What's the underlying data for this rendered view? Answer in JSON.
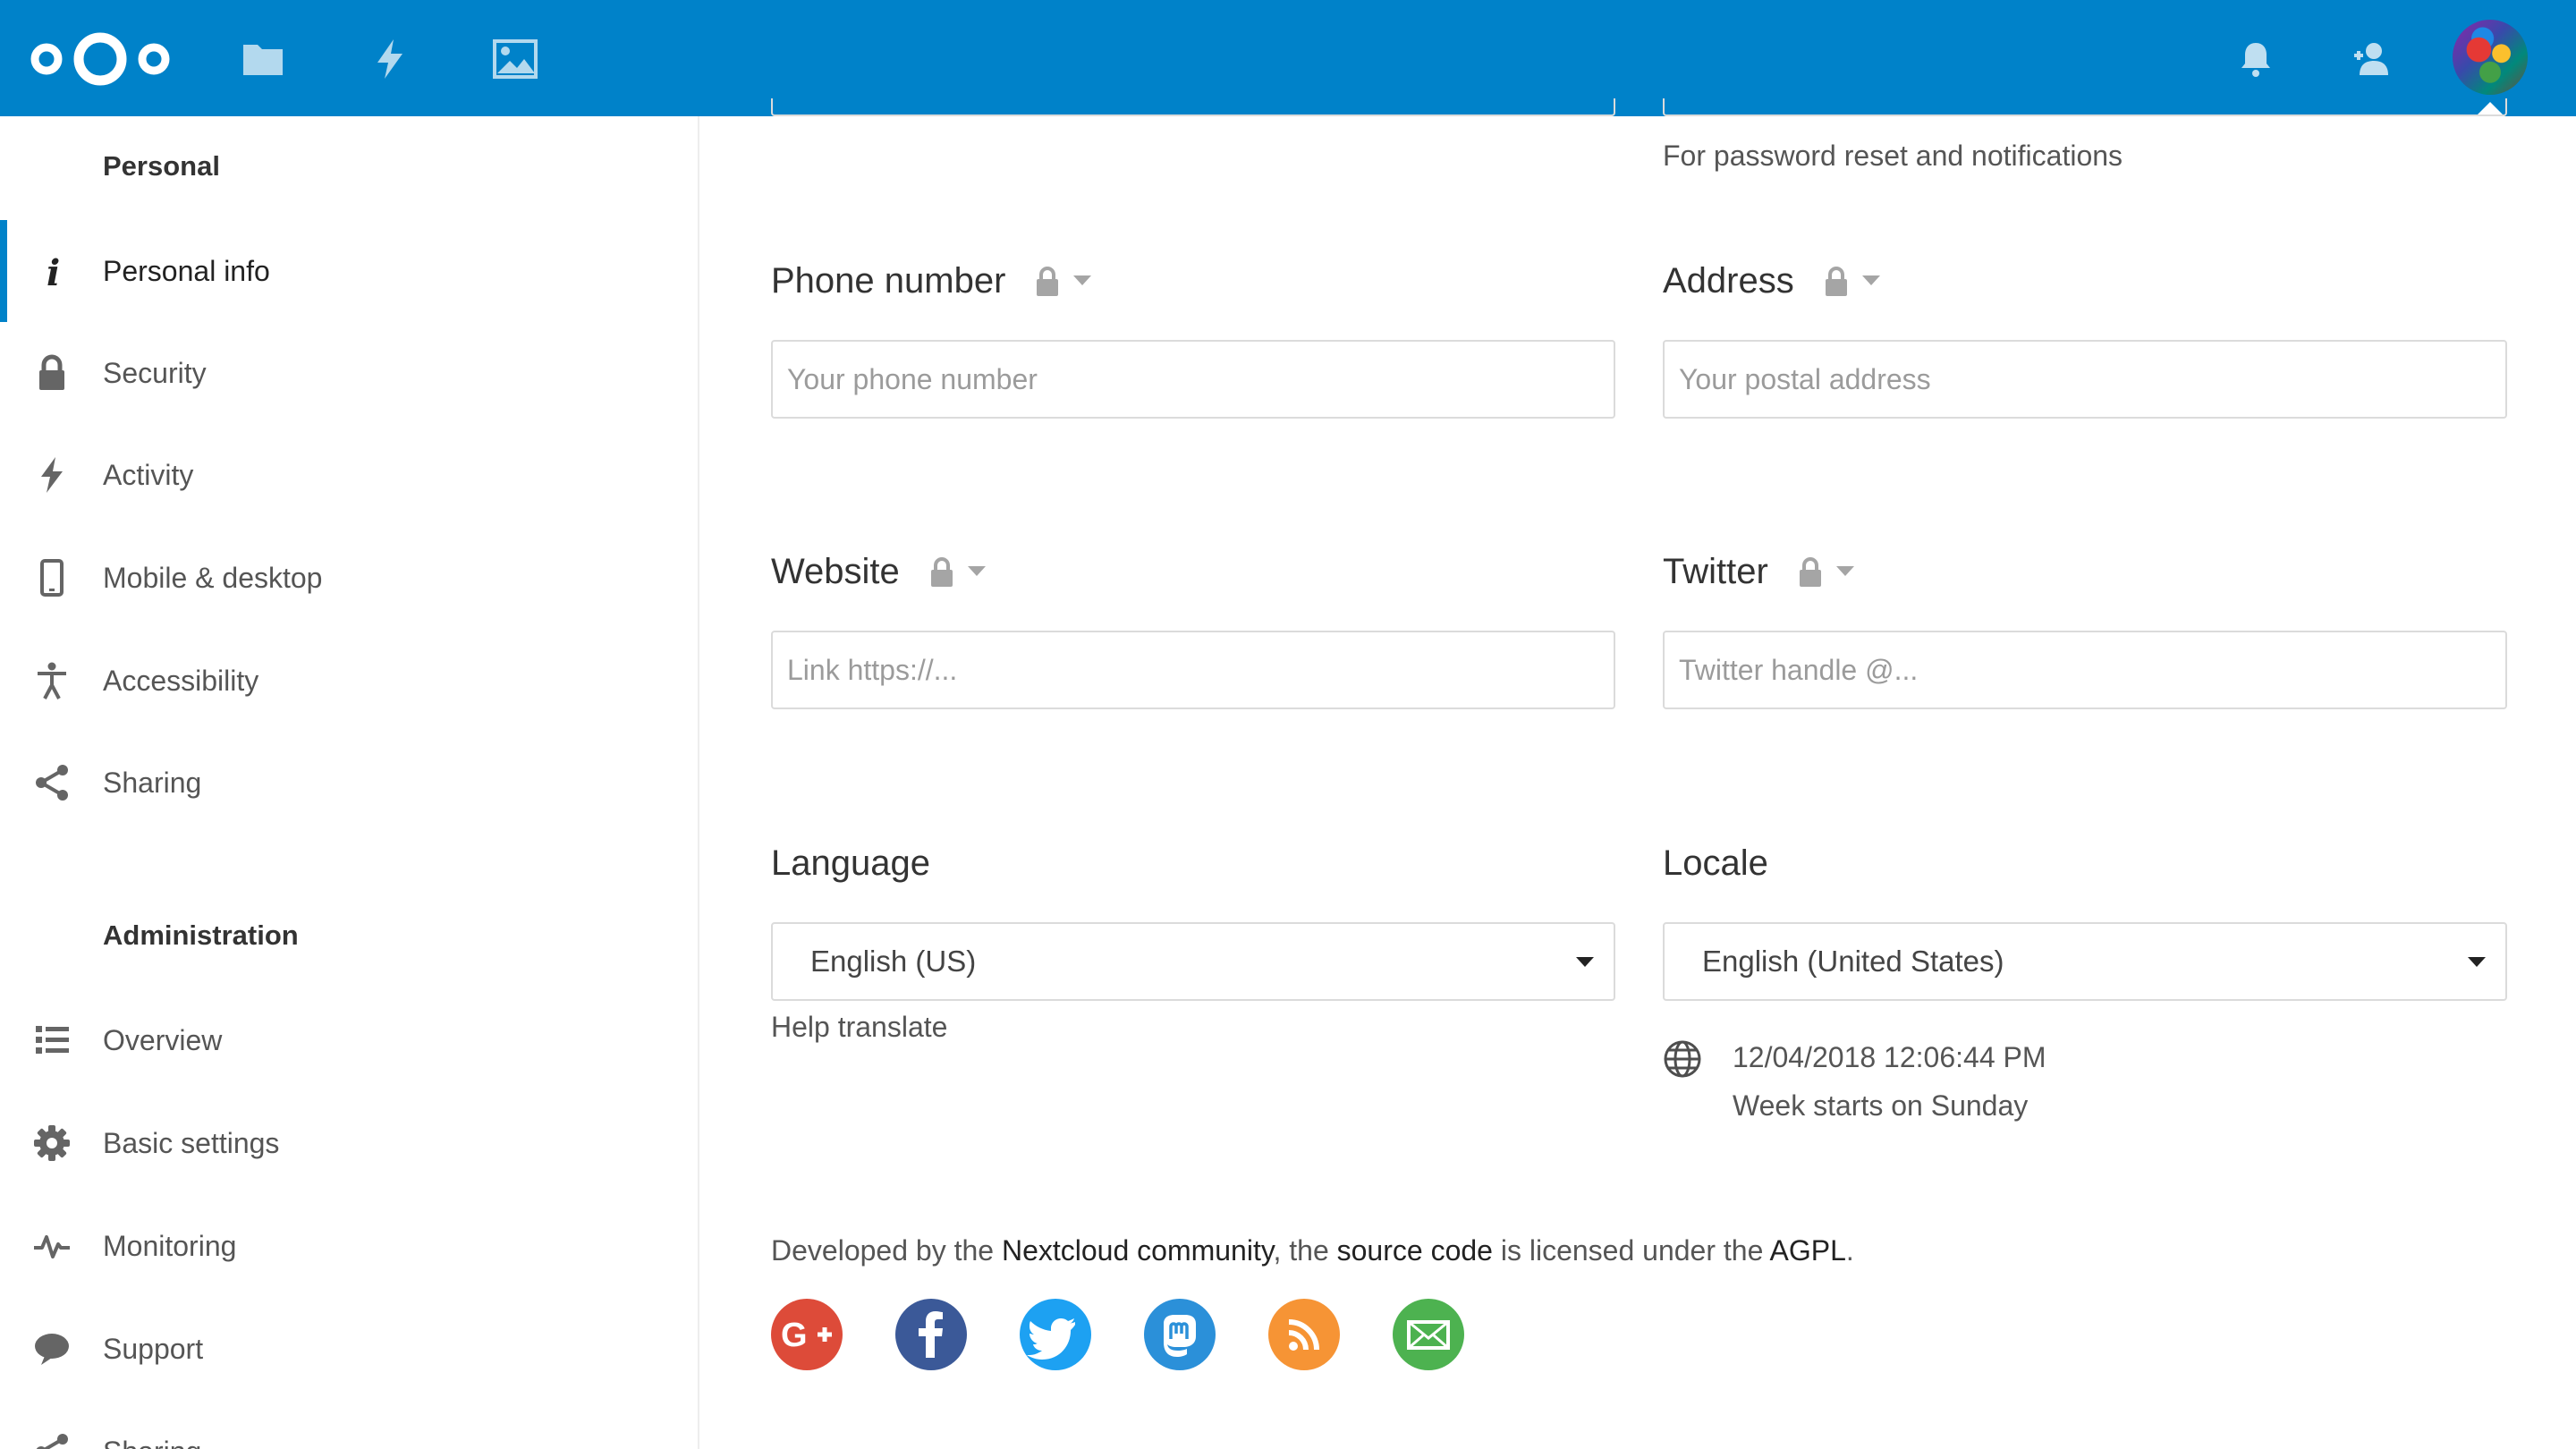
{
  "header": {
    "apps": [
      "Files",
      "Activity",
      "Gallery"
    ],
    "right": [
      "Notifications",
      "Contacts",
      "Settings menu"
    ]
  },
  "sidebar": {
    "personal_title": "Personal",
    "personal_items": [
      {
        "label": "Personal info",
        "icon": "info-icon",
        "active": true
      },
      {
        "label": "Security",
        "icon": "lock-icon"
      },
      {
        "label": "Activity",
        "icon": "lightning-icon"
      },
      {
        "label": "Mobile & desktop",
        "icon": "phone-icon"
      },
      {
        "label": "Accessibility",
        "icon": "accessibility-icon"
      },
      {
        "label": "Sharing",
        "icon": "share-icon"
      }
    ],
    "admin_title": "Administration",
    "admin_items": [
      {
        "label": "Overview",
        "icon": "list-icon"
      },
      {
        "label": "Basic settings",
        "icon": "gear-icon"
      },
      {
        "label": "Monitoring",
        "icon": "pulse-icon"
      },
      {
        "label": "Support",
        "icon": "chat-icon"
      },
      {
        "label": "Sharing",
        "icon": "share-icon"
      }
    ]
  },
  "main": {
    "email_hint": "For password reset and notifications",
    "phone": {
      "label": "Phone number",
      "placeholder": "Your phone number",
      "value": ""
    },
    "address": {
      "label": "Address",
      "placeholder": "Your postal address",
      "value": ""
    },
    "website": {
      "label": "Website",
      "placeholder": "Link https://...",
      "value": ""
    },
    "twitter": {
      "label": "Twitter",
      "placeholder": "Twitter handle @...",
      "value": ""
    },
    "language": {
      "label": "Language",
      "selected": "English (US)",
      "help": "Help translate"
    },
    "locale": {
      "label": "Locale",
      "selected": "English (United States)",
      "datetime": "12/04/2018 12:06:44 PM",
      "week_start": "Week starts on Sunday"
    }
  },
  "footer": {
    "prefix": "Developed by the ",
    "community_link": "Nextcloud community",
    "middle": ", the ",
    "source_link": "source code",
    "suffix": " is licensed under the ",
    "license_link": "AGPL",
    "end": ".",
    "social": [
      {
        "name": "google-plus",
        "color": "#dd4b39"
      },
      {
        "name": "facebook",
        "color": "#3b5998"
      },
      {
        "name": "twitter",
        "color": "#1da1f2"
      },
      {
        "name": "mastodon",
        "color": "#2b90d9"
      },
      {
        "name": "rss",
        "color": "#f69435"
      },
      {
        "name": "email",
        "color": "#4db250"
      }
    ]
  },
  "colors": {
    "primary": "#0082c9"
  }
}
